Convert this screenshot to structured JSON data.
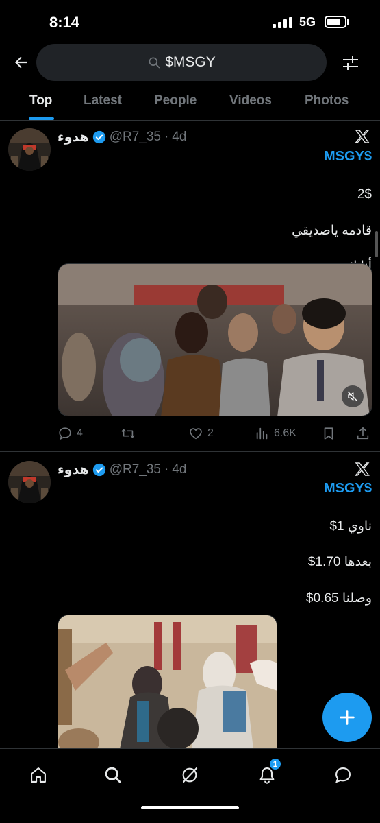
{
  "status_bar": {
    "time": "8:14",
    "network": "5G"
  },
  "search": {
    "query": "$MSGY"
  },
  "tabs": [
    {
      "label": "Top",
      "active": true
    },
    {
      "label": "Latest",
      "active": false
    },
    {
      "label": "People",
      "active": false
    },
    {
      "label": "Videos",
      "active": false
    },
    {
      "label": "Photos",
      "active": false
    }
  ],
  "tweets": [
    {
      "display_name": "هدوء",
      "handle": "@R7_35",
      "separator": "·",
      "ago": "4d",
      "cashtag": "$MSGY",
      "lines": [
        "2$",
        "قادمه ياصديقي",
        "أنا اثق"
      ],
      "media": {
        "type": "video",
        "muted": true
      },
      "stats": {
        "replies": "4",
        "retweets": "",
        "likes": "2",
        "views": "6.6K"
      }
    },
    {
      "display_name": "هدوء",
      "handle": "@R7_35",
      "separator": "·",
      "ago": "4d",
      "cashtag": "$MSGY",
      "lines": [
        "ناوي 1$",
        "بعدها 1.70$",
        "وصلنا 0.65$"
      ],
      "media": {
        "type": "video"
      }
    }
  ],
  "bottom_nav": {
    "items": [
      "home-icon",
      "search-icon",
      "grok-icon",
      "notifications-icon",
      "messages-icon"
    ],
    "notifications_badge": "1"
  },
  "colors": {
    "accent": "#1d9bf0",
    "background": "#000000",
    "muted_text": "#71767b",
    "divider": "#2f3336"
  },
  "fab": {
    "icon": "plus-icon"
  }
}
